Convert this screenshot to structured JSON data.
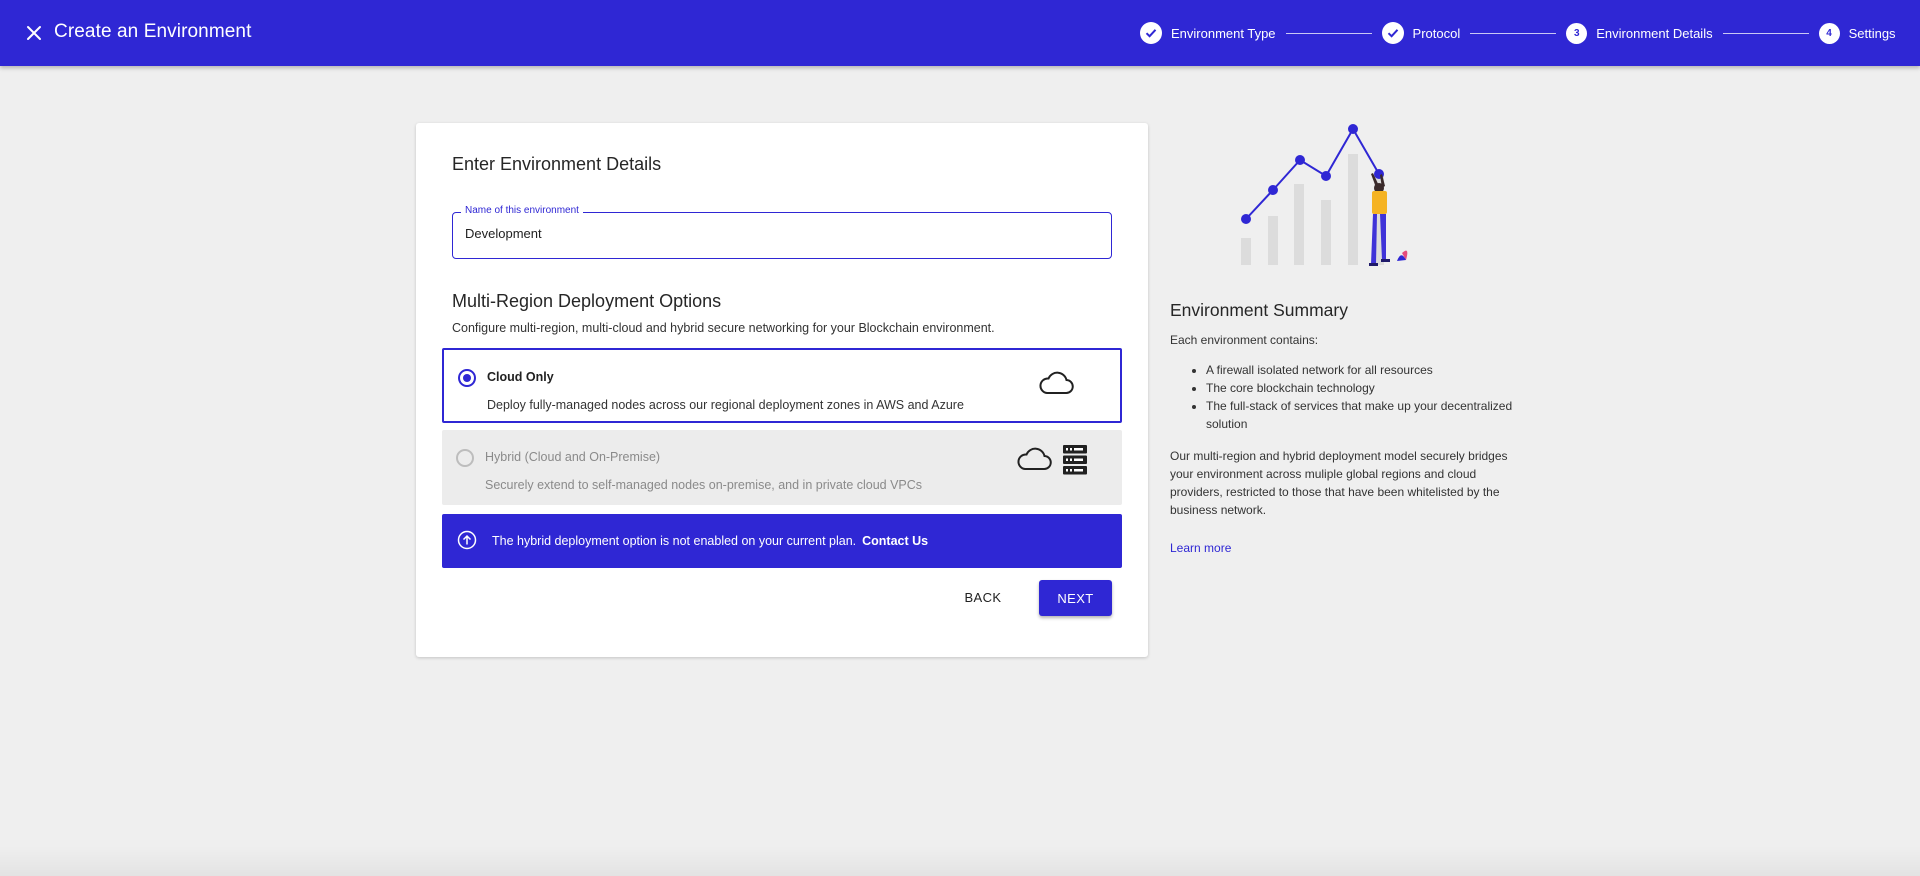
{
  "header": {
    "title": "Create an Environment",
    "close_icon": "close-icon"
  },
  "stepper": {
    "steps": [
      {
        "label": "Environment Type",
        "state": "completed",
        "icon": "check-icon"
      },
      {
        "label": "Protocol",
        "state": "completed",
        "icon": "check-icon"
      },
      {
        "label": "Environment Details",
        "state": "active",
        "number": "3"
      },
      {
        "label": "Settings",
        "state": "pending",
        "number": "4"
      }
    ]
  },
  "form": {
    "heading": "Enter Environment Details",
    "name_field": {
      "label": "Name of this environment",
      "value": "Development"
    },
    "deployment": {
      "title": "Multi-Region Deployment Options",
      "description": "Configure multi-region, multi-cloud and hybrid secure networking for your Blockchain environment.",
      "options": [
        {
          "title": "Cloud Only",
          "description": "Deploy fully-managed nodes across our regional deployment zones in AWS and Azure",
          "selected": true,
          "icon": "cloud-icon"
        },
        {
          "title": "Hybrid (Cloud and On-Premise)",
          "description": "Securely extend to self-managed nodes on-premise, and in private cloud VPCs",
          "selected": false,
          "disabled": true,
          "icon": "cloud-server-icon"
        }
      ]
    },
    "banner": {
      "text": "The hybrid deployment option is not enabled on your current plan.",
      "link": "Contact Us",
      "icon": "upgrade-arrow-icon"
    },
    "buttons": {
      "back": "BACK",
      "next": "NEXT"
    }
  },
  "summary": {
    "title": "Environment Summary",
    "intro": "Each environment contains:",
    "items": [
      "A firewall isolated network for all resources",
      "The core blockchain technology",
      "The full-stack of services that make up your decentralized solution"
    ],
    "paragraph": "Our multi-region and hybrid deployment model securely bridges your environment across muliple global regions and cloud providers, restricted to those that have been whitelisted by the business network.",
    "link": "Learn more"
  },
  "colors": {
    "primary": "#2f27d4",
    "background": "#efefef",
    "card": "#ffffff"
  }
}
